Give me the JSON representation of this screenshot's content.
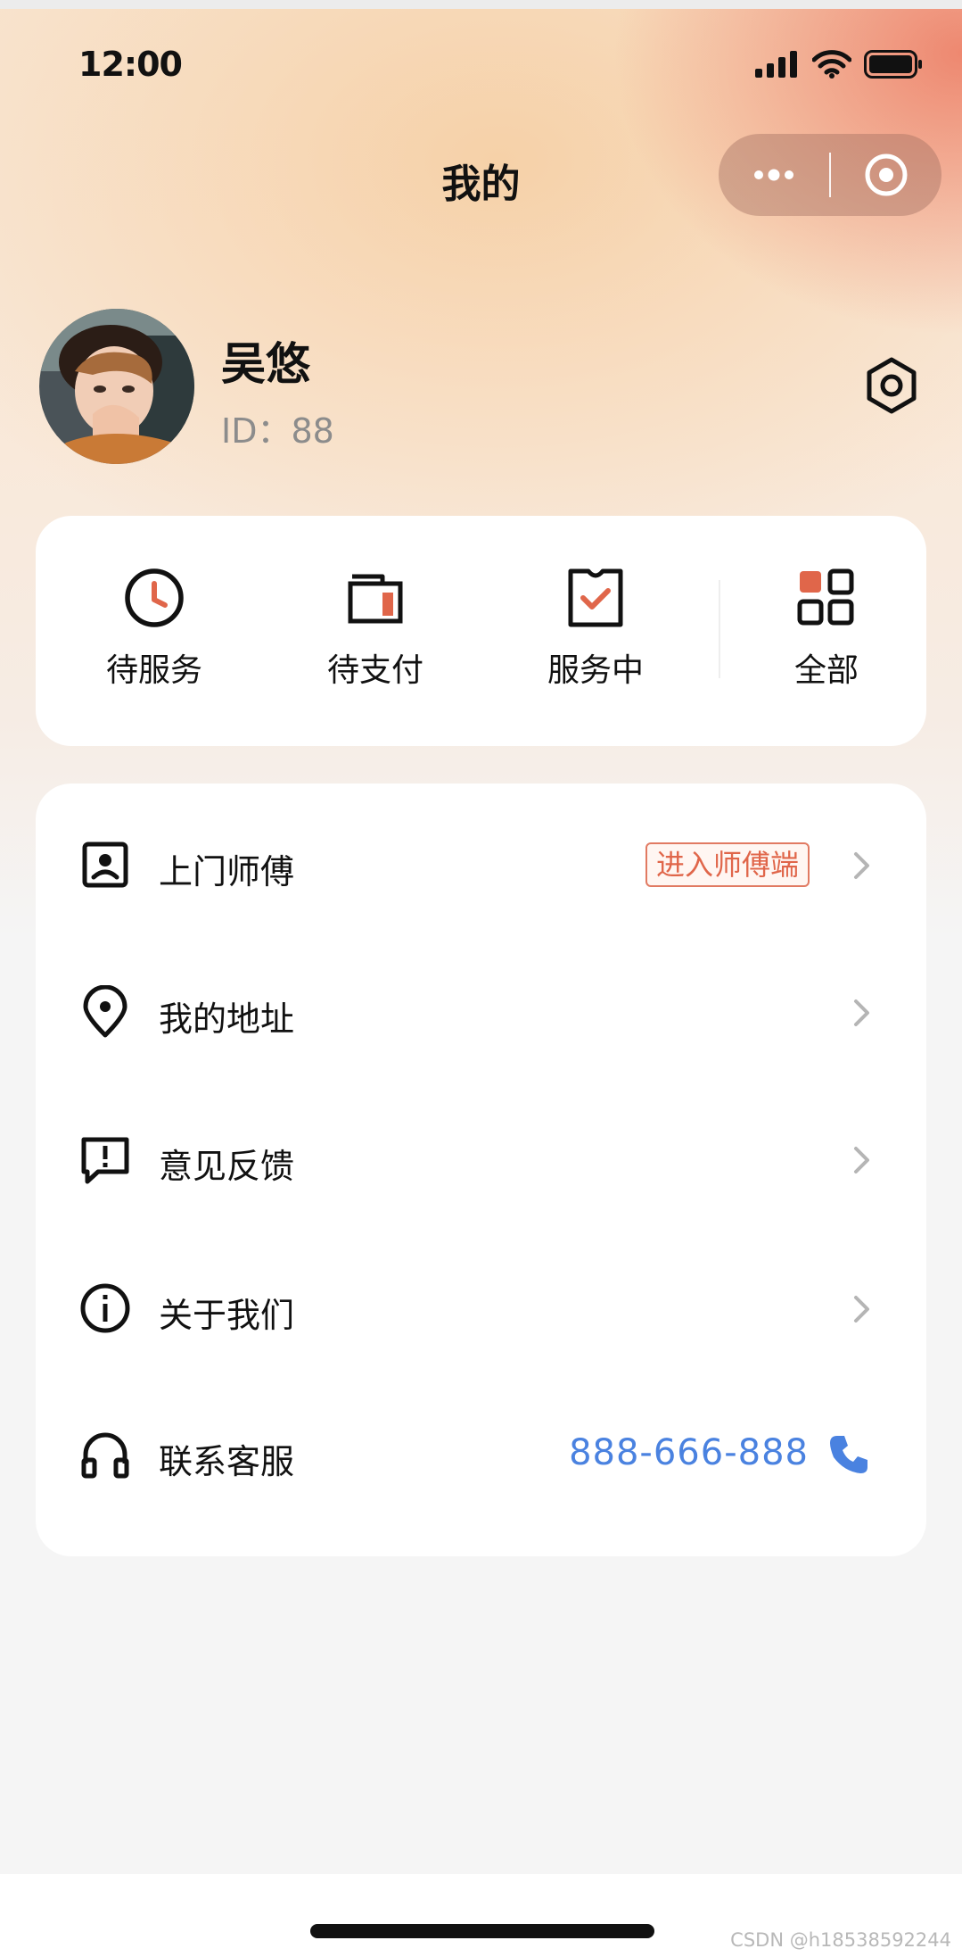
{
  "status_bar": {
    "time": "12:00",
    "icons": [
      "signal-icon",
      "wifi-icon",
      "battery-icon"
    ]
  },
  "nav": {
    "title": "我的",
    "capsule": [
      "more-icon",
      "close-target-icon"
    ]
  },
  "profile": {
    "name": "吴悠",
    "id_text": "ID：88",
    "settings_icon": "settings-hexagon-icon"
  },
  "orders": {
    "items": [
      {
        "label": "待服务",
        "icon": "clock-icon"
      },
      {
        "label": "待支付",
        "icon": "wallet-icon"
      },
      {
        "label": "服务中",
        "icon": "ticket-check-icon"
      },
      {
        "label": "全部",
        "icon": "grid-icon"
      }
    ]
  },
  "menu": {
    "items": [
      {
        "label": "上门师傅",
        "icon": "contact-card-icon",
        "tag": "进入师傅端"
      },
      {
        "label": "我的地址",
        "icon": "location-pin-icon"
      },
      {
        "label": "意见反馈",
        "icon": "feedback-icon"
      },
      {
        "label": "关于我们",
        "icon": "info-icon"
      },
      {
        "label": "联系客服",
        "icon": "headset-icon",
        "phone": "888-666-888"
      }
    ]
  },
  "colors": {
    "accent": "#e0664a",
    "link_blue": "#4a82e0"
  },
  "watermark": "CSDN @h18538592244"
}
